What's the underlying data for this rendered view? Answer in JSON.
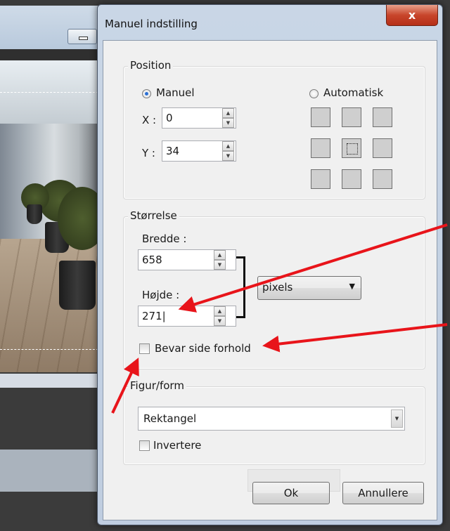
{
  "dialog": {
    "title": "Manuel indstilling",
    "close_glyph": "x"
  },
  "position": {
    "group_label": "Position",
    "manual_label": "Manuel",
    "automatic_label": "Automatisk",
    "manual_selected": true,
    "x_label": "X :",
    "x_value": "0",
    "y_label": "Y :",
    "y_value": "34",
    "anchor_selected": "center"
  },
  "size": {
    "group_label": "Størrelse",
    "width_label": "Bredde :",
    "width_value": "658",
    "height_label": "Højde :",
    "height_value": "271|",
    "unit_selected": "pixels",
    "keep_aspect_label": "Bevar side forhold",
    "keep_aspect_checked": false
  },
  "shape": {
    "group_label": "Figur/form",
    "shape_selected": "Rektangel",
    "invert_label": "Invertere",
    "invert_checked": false
  },
  "buttons": {
    "ok_label": "Ok",
    "cancel_label": "Annullere"
  },
  "colors": {
    "annotation_arrow": "#e8141a",
    "close_button": "#c8452b",
    "radio_selected": "#2a6fd4"
  },
  "icons": {
    "close": "close-icon",
    "spin_up": "chevron-up-icon",
    "spin_down": "chevron-down-icon",
    "dropdown": "chevron-down-icon"
  }
}
